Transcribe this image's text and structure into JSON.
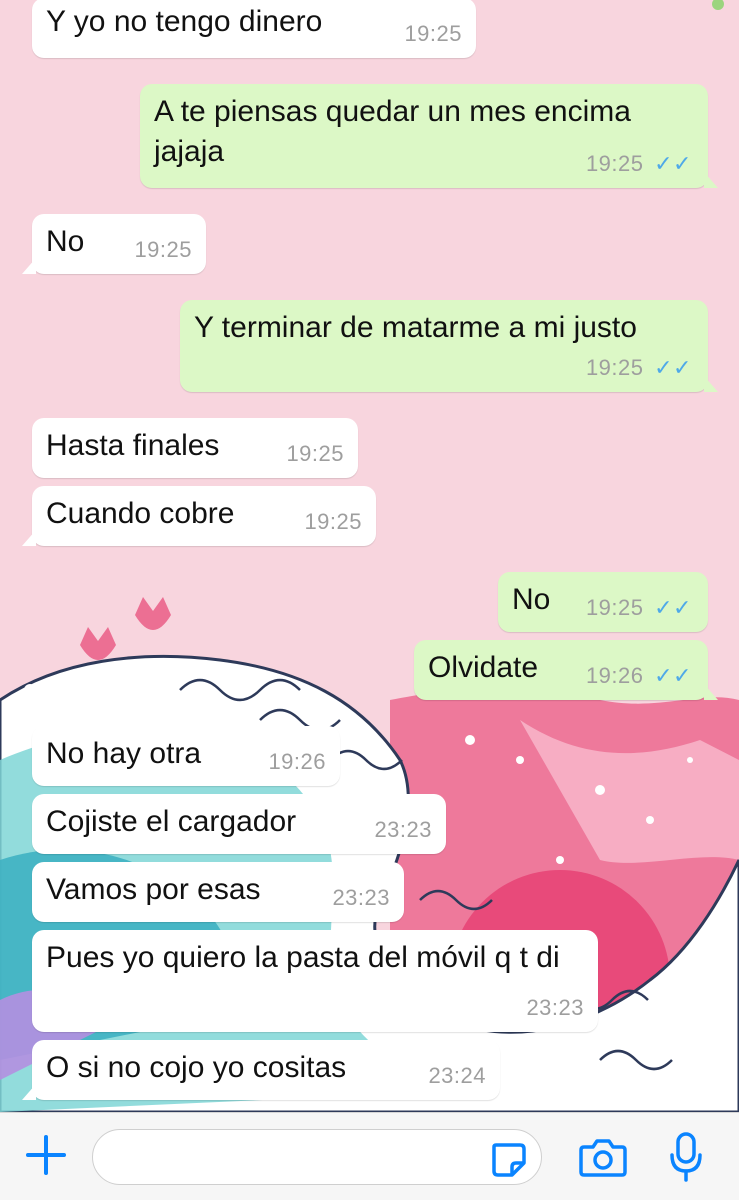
{
  "colors": {
    "background": "#f8d5de",
    "incoming_bubble": "#ffffff",
    "outgoing_bubble": "#dcf8c6",
    "read_ticks": "#4fa9e8",
    "accent": "#0a84ff"
  },
  "messages": [
    {
      "direction": "in",
      "text": "Y yo no tengo dinero",
      "time": "19:25"
    },
    {
      "direction": "out",
      "text": "A te piensas quedar un mes encima jajaja",
      "time": "19:25",
      "status": "read"
    },
    {
      "direction": "in",
      "text": "No",
      "time": "19:25"
    },
    {
      "direction": "out",
      "text": "Y terminar de matarme a mi justo",
      "time": "19:25",
      "status": "read"
    },
    {
      "direction": "in",
      "text": "Hasta finales",
      "time": "19:25"
    },
    {
      "direction": "in",
      "text": "Cuando cobre",
      "time": "19:25"
    },
    {
      "direction": "out",
      "text": "No",
      "time": "19:25",
      "status": "read"
    },
    {
      "direction": "out",
      "text": "Olvidate",
      "time": "19:26",
      "status": "read"
    },
    {
      "direction": "in",
      "text": "No hay otra",
      "time": "19:26"
    },
    {
      "direction": "in",
      "text": "Cojiste el cargador",
      "time": "23:23"
    },
    {
      "direction": "in",
      "text": "Vamos por esas",
      "time": "23:23"
    },
    {
      "direction": "in",
      "text": "Pues yo quiero la pasta del móvil q t di",
      "time": "23:23"
    },
    {
      "direction": "in",
      "text": "O si no cojo yo cositas",
      "time": "23:24"
    }
  ],
  "read_ticks_glyph": "✓✓",
  "input_bar": {
    "placeholder": "",
    "value": "",
    "icons": [
      "plus-icon",
      "sticker-icon",
      "camera-icon",
      "microphone-icon"
    ]
  }
}
